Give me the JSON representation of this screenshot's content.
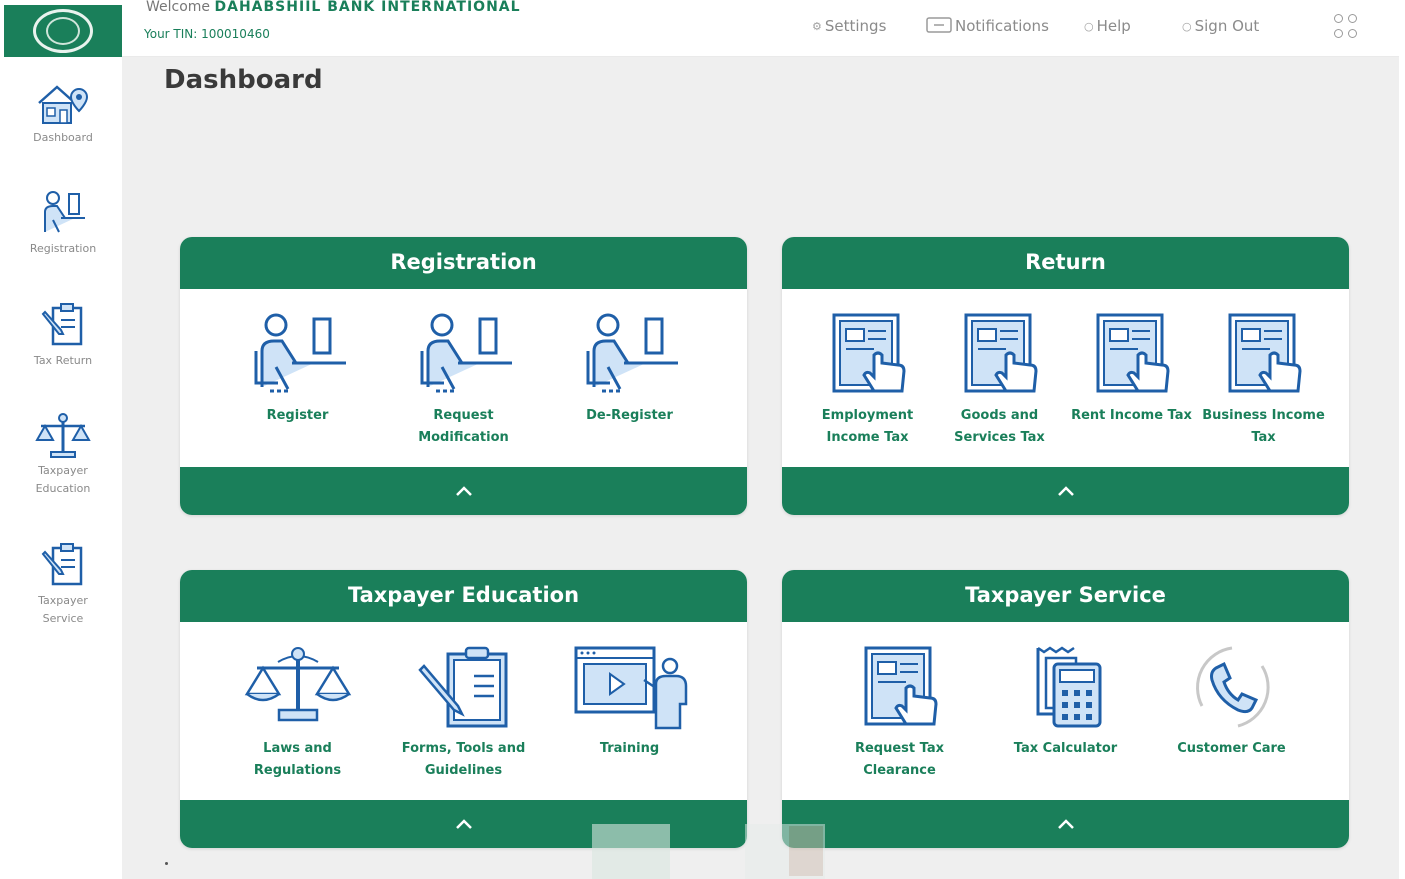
{
  "header": {
    "welcome_prefix": "Welcome",
    "welcome_name": "DAHABSHIIL BANK INTERNATIONAL",
    "tin_text": "Your TIN: 100010460",
    "nav": [
      {
        "label": "Settings",
        "icon": "gear-icon"
      },
      {
        "label": "Notifications",
        "icon": "message-icon"
      },
      {
        "label": "Help",
        "icon": "help-icon"
      },
      {
        "label": "Sign Out",
        "icon": "power-icon"
      }
    ]
  },
  "sidebar": {
    "items": [
      {
        "label": "Dashboard",
        "icon": "house-location-icon"
      },
      {
        "label": "Registration",
        "icon": "person-at-desk-icon"
      },
      {
        "label": "Tax Return",
        "icon": "clipboard-pen-icon"
      },
      {
        "label": "Taxpayer Education",
        "icon": "scales-icon"
      },
      {
        "label": "Taxpayer Service",
        "icon": "clipboard-pen-icon"
      }
    ]
  },
  "main": {
    "title": "Dashboard",
    "cards": [
      {
        "title": "Registration",
        "tiles": [
          {
            "label": "Register",
            "icon": "person-at-desk-icon"
          },
          {
            "label": "Request Modification",
            "icon": "person-at-desk-icon"
          },
          {
            "label": "De-Register",
            "icon": "person-at-desk-icon"
          }
        ]
      },
      {
        "title": "Return",
        "tiles": [
          {
            "label": "Employment Income Tax",
            "icon": "document-hand-icon"
          },
          {
            "label": "Goods and Services Tax",
            "icon": "document-hand-icon"
          },
          {
            "label": "Rent Income Tax",
            "icon": "document-hand-icon"
          },
          {
            "label": "Business Income Tax",
            "icon": "document-hand-icon"
          }
        ]
      },
      {
        "title": "Taxpayer Education",
        "tiles": [
          {
            "label": "Laws and Regulations",
            "icon": "scales-icon"
          },
          {
            "label": "Forms, Tools and Guidelines",
            "icon": "clipboard-pen-icon"
          },
          {
            "label": "Training",
            "icon": "video-presenter-icon"
          }
        ]
      },
      {
        "title": "Taxpayer Service",
        "tiles": [
          {
            "label": "Request Tax Clearance",
            "icon": "document-hand-icon"
          },
          {
            "label": "Tax Calculator",
            "icon": "calculator-icon"
          },
          {
            "label": "Customer Care",
            "icon": "phone-icon"
          }
        ]
      }
    ]
  },
  "colors": {
    "brand_green": "#1a7f5a",
    "icon_blue": "#1f5fa8",
    "icon_light_blue": "#cfe3f7",
    "background": "#efefef"
  }
}
